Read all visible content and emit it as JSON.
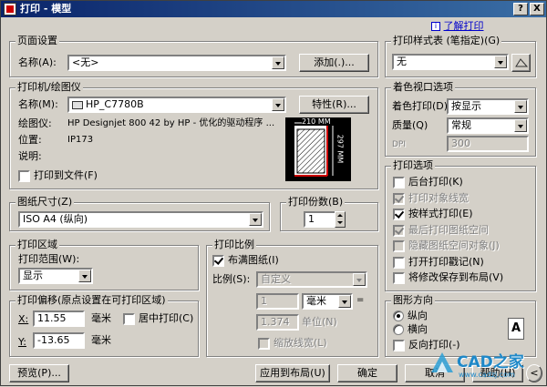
{
  "window": {
    "title": "打印 - 模型",
    "help_btn": "?",
    "close_btn": "X"
  },
  "help_link": "了解打印",
  "page_setup": {
    "title": "页面设置",
    "name_label": "名称(A):",
    "name_value": "<无>",
    "add_button": "添加(.)..."
  },
  "printer": {
    "title": "打印机/绘图仪",
    "name_label": "名称(M):",
    "name_value": "HP_C7780B",
    "properties_button": "特性(R)...",
    "plotter_label": "绘图仪:",
    "plotter_value": "HP Designjet 800 42 by HP - 优化的驱动程序 ...",
    "location_label": "位置:",
    "location_value": "IP173",
    "desc_label": "说明:",
    "print_to_file": "打印到文件(F)",
    "preview_width": "210 MM",
    "preview_height": "297 MM"
  },
  "paper_size": {
    "title": "图纸尺寸(Z)",
    "value": "ISO A4  (纵向)"
  },
  "copies": {
    "title": "打印份数(B)",
    "value": "1"
  },
  "plot_area": {
    "title": "打印区域",
    "range_label": "打印范围(W):",
    "range_value": "显示"
  },
  "plot_scale": {
    "title": "打印比例",
    "fit_paper": "布满图纸(I)",
    "scale_label": "比例(S):",
    "scale_value": "自定义",
    "value1": "1",
    "unit_value": "毫米",
    "equals": "=",
    "value2": "1.374",
    "unit_label": "单位(N)",
    "scale_lineweights": "缩放线宽(L)"
  },
  "plot_offset": {
    "title": "打印偏移(原点设置在可打印区域)",
    "x_label": "X:",
    "x_value": "11.55",
    "x_unit": "毫米",
    "center_plot": "居中打印(C)",
    "y_label": "Y:",
    "y_value": "-13.65",
    "y_unit": "毫米"
  },
  "plot_style": {
    "title": "打印样式表 (笔指定)(G)",
    "value": "无"
  },
  "shaded": {
    "title": "着色视口选项",
    "shade_label": "着色打印(D)",
    "shade_value": "按显示",
    "quality_label": "质量(Q)",
    "quality_value": "常规",
    "dpi_label": "DPI",
    "dpi_value": "300"
  },
  "plot_options": {
    "title": "打印选项",
    "items": [
      {
        "label": "后台打印(K)",
        "checked": false,
        "disabled": false
      },
      {
        "label": "打印对象线宽",
        "checked": true,
        "disabled": true
      },
      {
        "label": "按样式打印(E)",
        "checked": true,
        "disabled": false
      },
      {
        "label": "最后打印图纸空间",
        "checked": true,
        "disabled": true
      },
      {
        "label": "隐藏图纸空间对象(J)",
        "checked": false,
        "disabled": true
      },
      {
        "label": "打开打印戳记(N)",
        "checked": false,
        "disabled": false
      },
      {
        "label": "将修改保存到布局(V)",
        "checked": false,
        "disabled": false
      }
    ]
  },
  "orientation": {
    "title": "图形方向",
    "portrait": "纵向",
    "landscape": "横向",
    "upside_down": "反向打印(-)",
    "icon_letter": "A"
  },
  "footer": {
    "preview": "预览(P)...",
    "apply_layout": "应用到布局(U)",
    "ok": "确定",
    "cancel": "取消",
    "help": "帮助(H)",
    "expand": "<"
  },
  "watermark": {
    "text": "CAD之家",
    "site": "www.cadzj.com"
  },
  "colors": {
    "title_start": "#0a246a",
    "title_end": "#3a6ea5",
    "face": "#d4d0c8",
    "link": "#0000cc"
  }
}
